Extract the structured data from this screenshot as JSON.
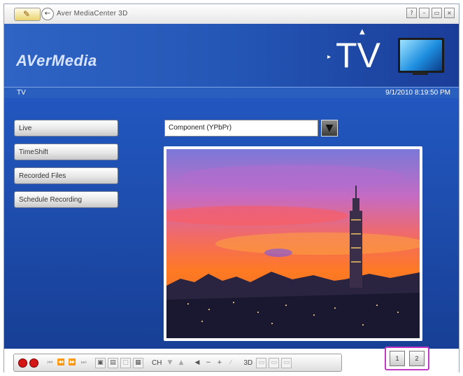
{
  "window": {
    "title": "Aver MediaCenter 3D",
    "controls": [
      "?",
      "–",
      "▭",
      "×"
    ]
  },
  "header": {
    "brand": "AVerMedia",
    "section_title": "TV"
  },
  "infobar": {
    "section": "TV",
    "datetime": "9/1/2010 8:19:50 PM"
  },
  "nav": {
    "items": [
      {
        "label": "Live"
      },
      {
        "label": "TimeShift"
      },
      {
        "label": "Recorded Files"
      },
      {
        "label": "Schedule Recording"
      }
    ]
  },
  "source": {
    "selected": "Component (YPbPr)"
  },
  "toolbar": {
    "ch_label": "CH",
    "threed_label": "3D",
    "layout_buttons": [
      "1",
      "2"
    ]
  },
  "colors": {
    "accent_blue": "#2257c0",
    "highlight_border": "#c13ac5",
    "record_red": "#d41616"
  }
}
